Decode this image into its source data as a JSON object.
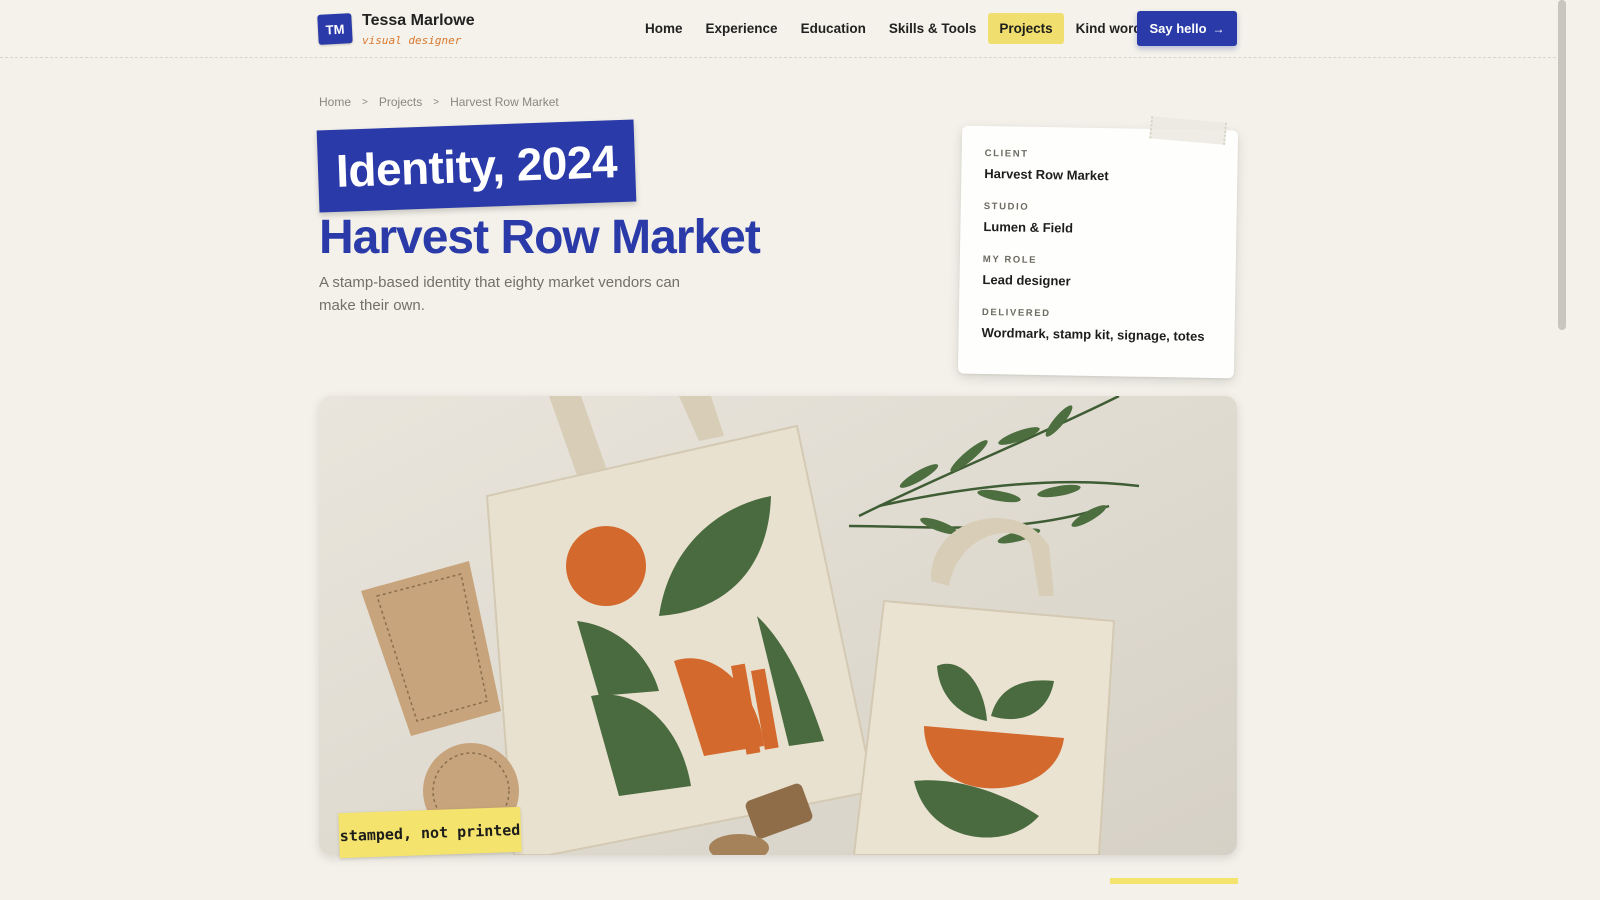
{
  "brand": {
    "initials": "TM",
    "name": "Tessa Marlowe",
    "tagline": "visual designer"
  },
  "nav": {
    "items": [
      {
        "label": "Home",
        "active": false
      },
      {
        "label": "Experience",
        "active": false
      },
      {
        "label": "Education",
        "active": false
      },
      {
        "label": "Skills & Tools",
        "active": false
      },
      {
        "label": "Projects",
        "active": true
      },
      {
        "label": "Kind words",
        "active": false
      }
    ],
    "cta_label": "Say hello",
    "cta_icon": "arrow-right-icon"
  },
  "breadcrumb": [
    "Home",
    "Projects",
    "Harvest Row Market"
  ],
  "project": {
    "tag": "Identity, 2024",
    "title": "Harvest Row Market",
    "subtitle": "A stamp-based identity that eighty market vendors can make their own."
  },
  "meta": [
    {
      "label": "CLIENT",
      "value": "Harvest Row Market"
    },
    {
      "label": "STUDIO",
      "value": "Lumen & Field"
    },
    {
      "label": "MY ROLE",
      "value": "Lead designer"
    },
    {
      "label": "DELIVERED",
      "value": "Wordmark, stamp kit, signage, totes"
    }
  ],
  "hero": {
    "caption": "stamped, not printed"
  },
  "colors": {
    "accent": "#2a3aa8",
    "highlight": "#f0df6e",
    "orange": "#d9782f",
    "green": "#4a6b3f",
    "background": "#f3f1e9"
  }
}
